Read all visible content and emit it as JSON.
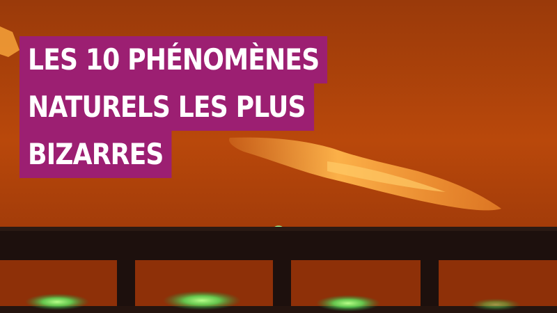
{
  "overlay": {
    "title_lines": [
      "LES 10 PHÉNOMÈNES",
      "NATURELS LES PLUS",
      "BIZARRES"
    ],
    "banner_color": "#9c1f72",
    "text_color": "#ffffff"
  },
  "scene": {
    "sky_color": "#b8480a",
    "cloud_color": "#ffb040",
    "railing_color": "#1b0f0c",
    "glow_color": "#7dff5a"
  }
}
